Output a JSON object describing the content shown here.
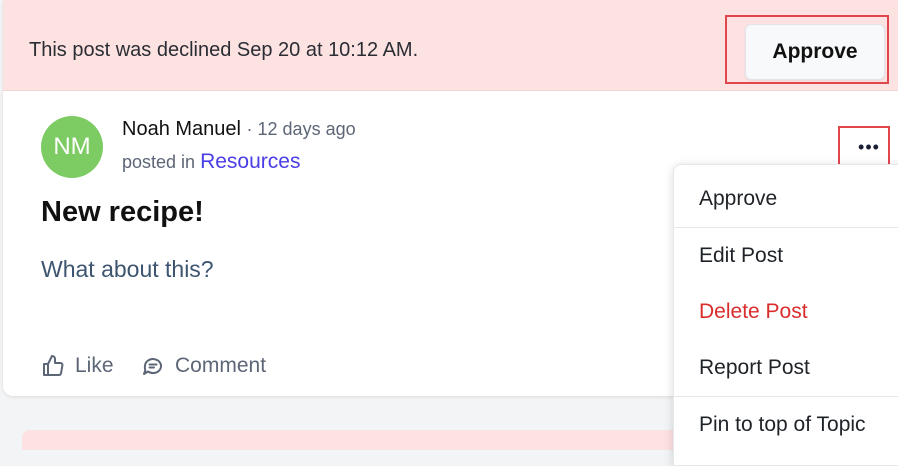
{
  "banner": {
    "message": "This post was declined Sep 20 at 10:12 AM.",
    "approve_label": "Approve"
  },
  "post": {
    "avatar_initials": "NM",
    "author": "Noah Manuel",
    "time_ago": "· 12 days ago",
    "posted_in_prefix": "posted in",
    "topic": "Resources",
    "title": "New recipe!",
    "body": "What about this?",
    "more_label": "•••"
  },
  "actions": {
    "like": "Like",
    "comment": "Comment"
  },
  "menu": {
    "items": [
      "Approve",
      "Edit Post",
      "Delete Post",
      "Report Post",
      "Pin to top of Topic"
    ]
  },
  "colors": {
    "banner_bg": "#fde2e2",
    "avatar_bg": "#7dcb63",
    "link": "#4a3ee6",
    "danger": "#d92d2d",
    "highlight": "#e0474c"
  }
}
